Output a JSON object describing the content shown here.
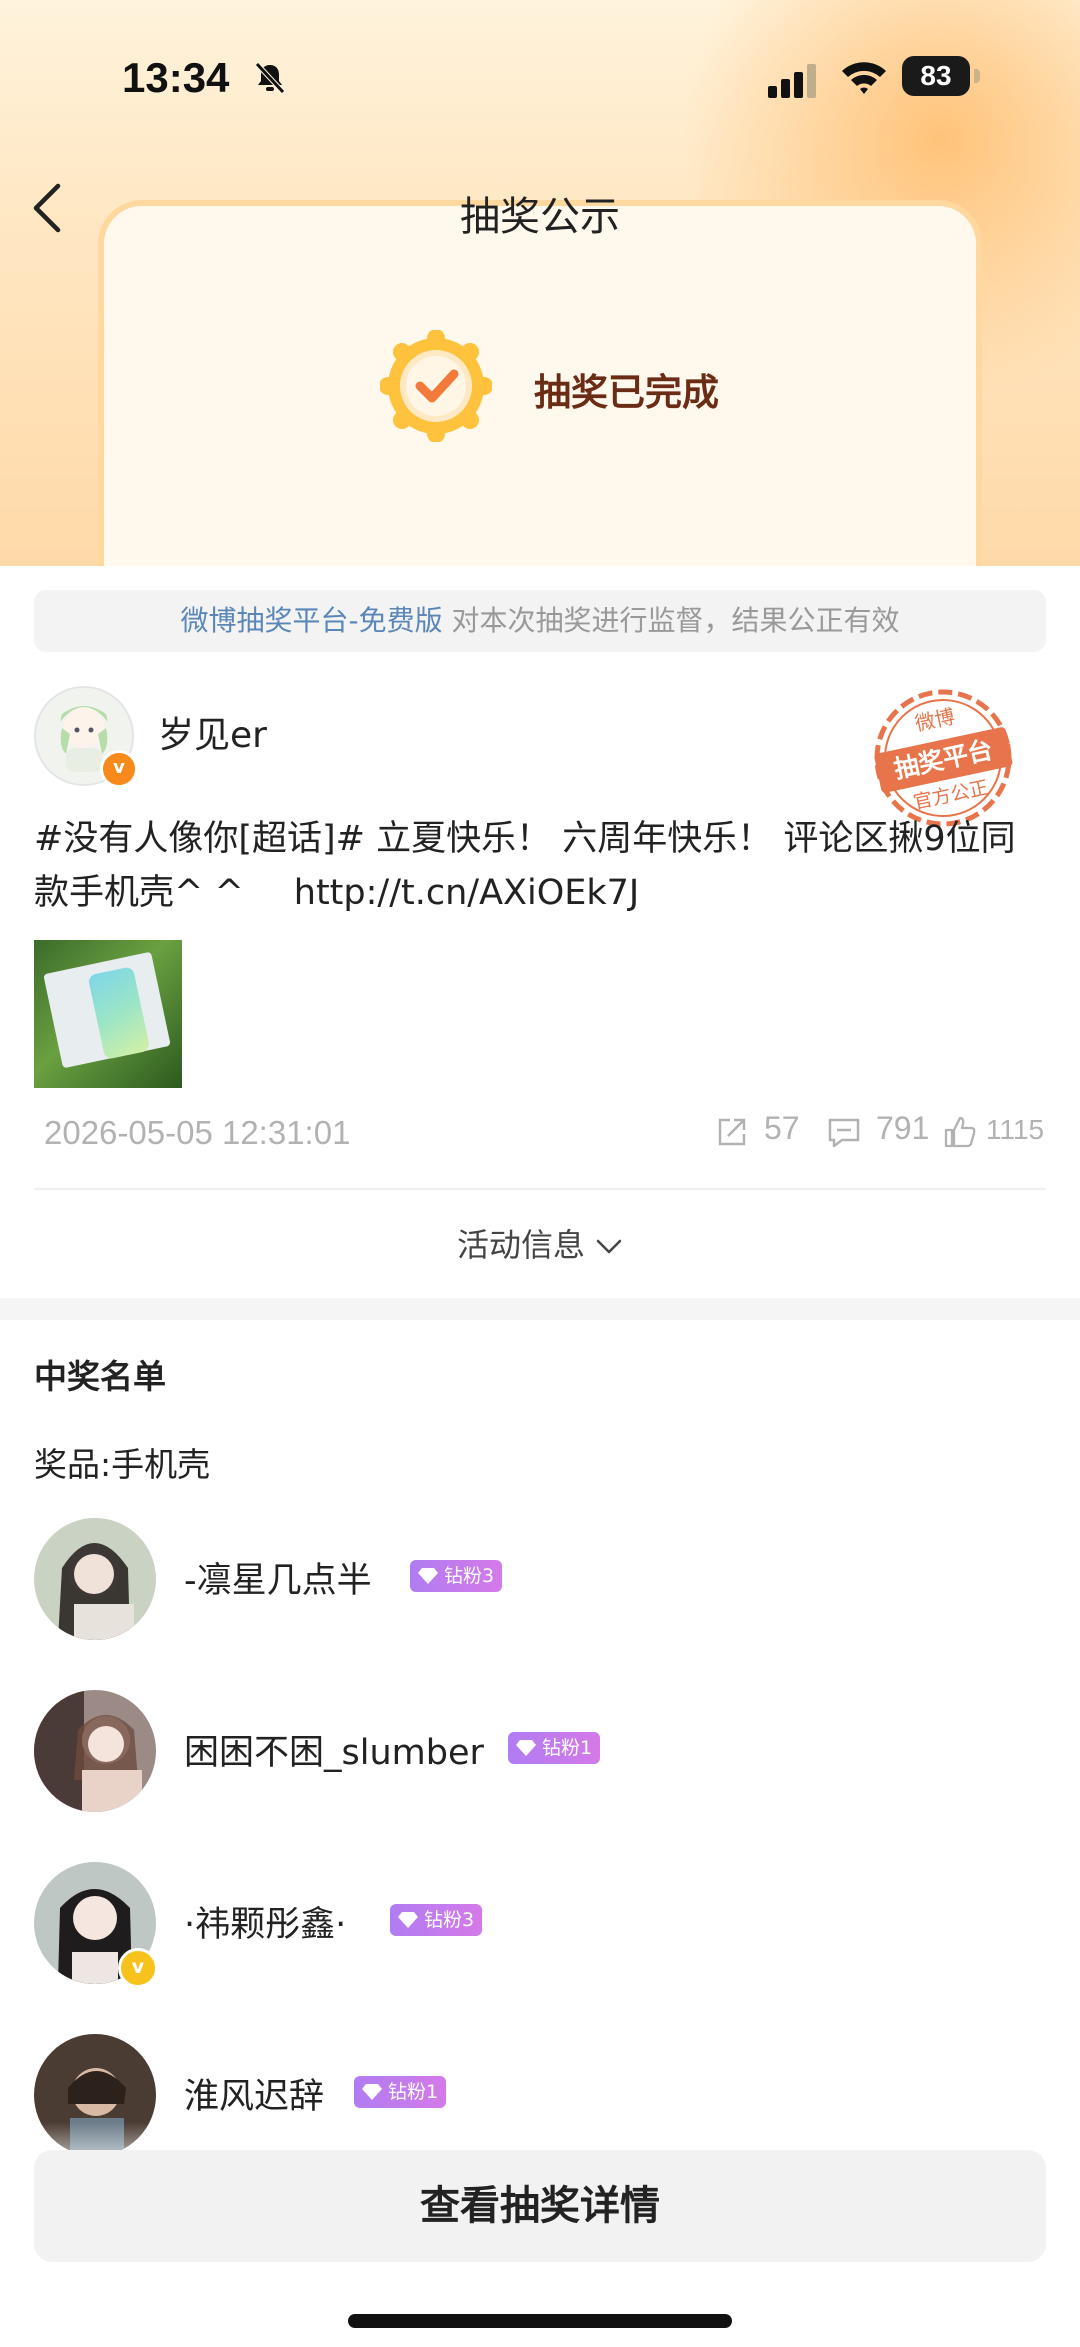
{
  "status_bar": {
    "time": "13:34",
    "battery": "83"
  },
  "nav": {
    "title": "抽奖公示"
  },
  "status_card": {
    "text": "抽奖已完成"
  },
  "notice": {
    "platform": "微博抽奖平台-免费版",
    "text": " 对本次抽奖进行监督，结果公正有效"
  },
  "stamp": {
    "line1": "微博",
    "line2": "抽奖平台",
    "line3": "官方公正"
  },
  "post": {
    "author": "岁见er",
    "text_line1": "#没有人像你[超话]# 立夏快乐！ 六周年快乐！ 评论区揪9位同",
    "text_line2_a": "款手机壳^ ^",
    "text_line2_b": "http://t.cn/AXiOEk7J",
    "timestamp": "2026-05-05 12:31:01",
    "shares": "57",
    "comments": "791",
    "likes": "1115",
    "activity_info": "活动信息"
  },
  "winners": {
    "title": "中奖名单",
    "prize": "奖品:手机壳",
    "list": [
      {
        "name": "-凛星几点半",
        "badge": "钻粉3"
      },
      {
        "name": "困困不困_slumber",
        "badge": "钻粉1"
      },
      {
        "name": "·祎颗彤鑫·",
        "badge": "钻粉3"
      },
      {
        "name": "淮风迟辞",
        "badge": "钻粉1"
      }
    ]
  },
  "footer": {
    "button": "查看抽奖详情"
  },
  "colors": {
    "accent_orange": "#f78a1a",
    "badge_purple": "#b07cf2",
    "link_blue": "#5b87b8"
  }
}
